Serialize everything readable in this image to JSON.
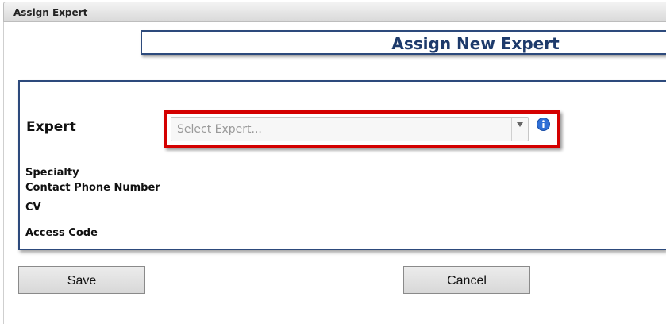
{
  "window": {
    "title": "Assign Expert"
  },
  "heading": {
    "title": "Assign New Expert"
  },
  "form": {
    "expert_label": "Expert",
    "expert_select": {
      "placeholder": "Select Expert...",
      "value": ""
    },
    "specialty_label": "Specialty",
    "phone_label": "Contact Phone Number",
    "cv_label": "CV",
    "access_code_label": "Access Code"
  },
  "buttons": {
    "save": "Save",
    "cancel": "Cancel"
  },
  "colors": {
    "heading": "#1d3a6b",
    "panel_border": "#2d4a7c",
    "highlight": "#d40000",
    "info_icon": "#2f6fd6"
  },
  "icons": {
    "info": "info-icon",
    "dropdown": "chevron-down-icon"
  }
}
